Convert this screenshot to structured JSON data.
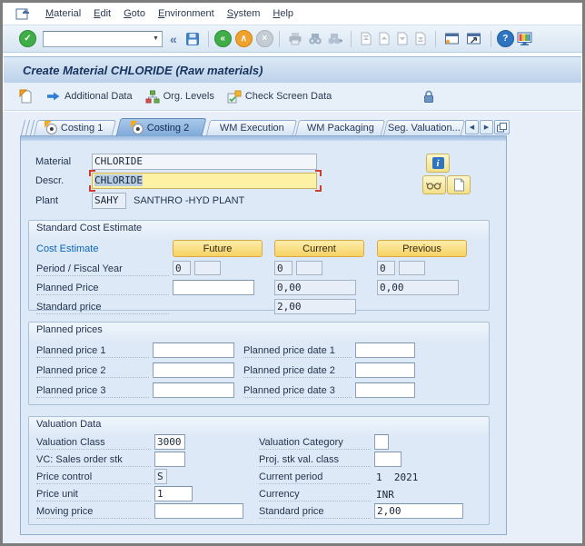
{
  "window": {
    "title": "Create Material CHLORIDE (Raw materials)"
  },
  "menu_bar": {
    "items": [
      "Material",
      "Edit",
      "Goto",
      "Environment",
      "System",
      "Help"
    ]
  },
  "toolbar": {
    "command_value": ""
  },
  "icons": {
    "enter": "✓",
    "collapse": "«",
    "back": "«",
    "exit": "∧",
    "cancel": "×",
    "dropdown": "▼",
    "help": "?",
    "info": "i",
    "tab_prev": "◀",
    "tab_next": "▶"
  },
  "app_toolbar": {
    "items": [
      "Additional Data",
      "Org. Levels",
      "Check Screen Data"
    ]
  },
  "tab_strip": {
    "tabs": [
      "Costing 1",
      "Costing 2",
      "WM Execution",
      "WM Packaging",
      "Seg. Valuation..."
    ],
    "active_tab": "Costing 2"
  },
  "header_fields": {
    "material_label": "Material",
    "material_value": "CHLORIDE",
    "descr_label": "Descr.",
    "descr_value": "CHLORIDE",
    "plant_label": "Plant",
    "plant_value": "SAHY",
    "plant_name": "SANTHRO -HYD PLANT"
  },
  "standard_cost_estimate": {
    "title": "Standard Cost Estimate",
    "cost_estimate_label": "Cost Estimate",
    "future_button": "Future",
    "current_button": "Current",
    "previous_button": "Previous",
    "period_fiscal_year_label": "Period / Fiscal Year",
    "future_period": "0",
    "future_year": "",
    "current_period": "0",
    "current_year": "",
    "previous_period": "0",
    "previous_year": "",
    "planned_price_label": "Planned Price",
    "future_planned_price": "",
    "current_planned_price": "0,00",
    "previous_planned_price": "0,00",
    "standard_price_label": "Standard price",
    "current_standard_price": "2,00"
  },
  "planned_prices": {
    "title": "Planned prices",
    "rows": [
      {
        "price_label": "Planned price 1",
        "price_value": "",
        "date_label": "Planned price date 1",
        "date_value": ""
      },
      {
        "price_label": "Planned price 2",
        "price_value": "",
        "date_label": "Planned price date 2",
        "date_value": ""
      },
      {
        "price_label": "Planned price 3",
        "price_value": "",
        "date_label": "Planned price date 3",
        "date_value": ""
      }
    ]
  },
  "valuation_data": {
    "title": "Valuation Data",
    "valuation_class_label": "Valuation Class",
    "valuation_class_value": "3000",
    "vc_sales_order_label": "VC: Sales order stk",
    "vc_sales_order_value": "",
    "price_control_label": "Price control",
    "price_control_value": "S",
    "price_unit_label": "Price unit",
    "price_unit_value": "1",
    "moving_price_label": "Moving price",
    "moving_price_value": "",
    "valuation_category_label": "Valuation Category",
    "valuation_category_value": "",
    "proj_stk_label": "Proj. stk val. class",
    "proj_stk_value": "",
    "current_period_label": "Current period",
    "current_period_value": "1  2021",
    "currency_label": "Currency",
    "currency_value": "INR",
    "standard_price_label": "Standard price",
    "standard_price_value": "2,00"
  },
  "colors": {
    "accent_button": "#f7d264",
    "highlight_field": "#fcf1a4",
    "active_tab": "#7fa9d8",
    "selection": "#b7cde4",
    "title_text": "#17335f"
  }
}
